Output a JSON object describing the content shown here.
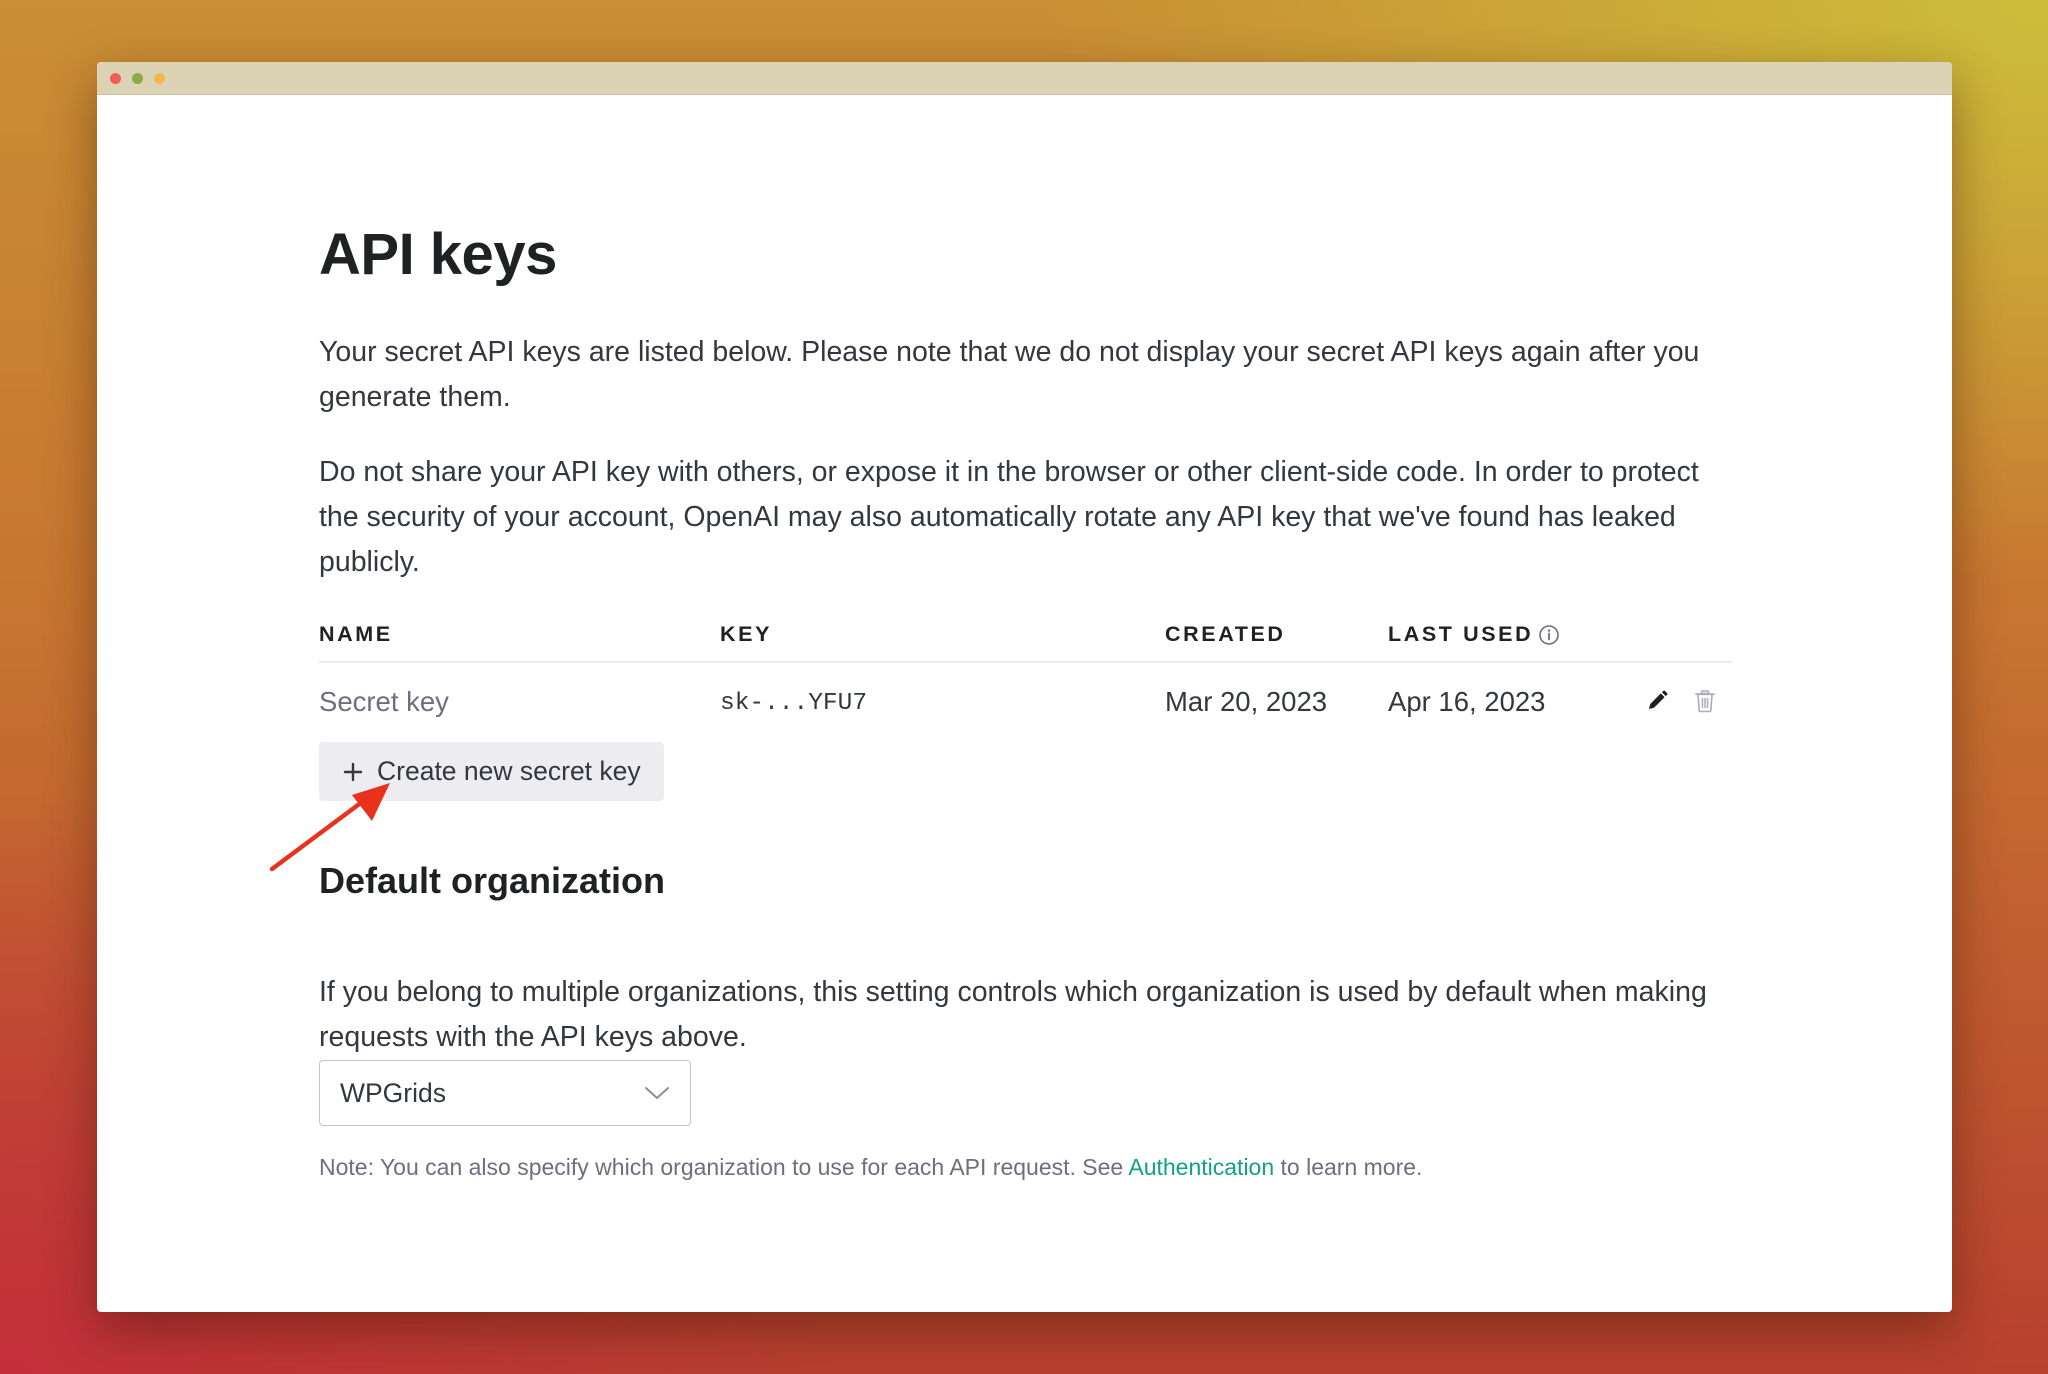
{
  "page": {
    "title": "API keys",
    "intro": "Your secret API keys are listed below. Please note that we do not display your secret API keys again after you generate them.",
    "warning": "Do not share your API key with others, or expose it in the browser or other client-side code. In order to protect the security of your account, OpenAI may also automatically rotate any API key that we've found has leaked publicly."
  },
  "keys_table": {
    "columns": {
      "name": "NAME",
      "key": "KEY",
      "created": "CREATED",
      "last_used": "LAST USED"
    },
    "rows": [
      {
        "name": "Secret key",
        "key": "sk-...YFU7",
        "created": "Mar 20, 2023",
        "last_used": "Apr 16, 2023"
      }
    ],
    "icons": {
      "info": "info-icon",
      "edit": "pencil-icon",
      "delete": "trash-icon"
    }
  },
  "create_button": {
    "label": "Create new secret key",
    "icon": "plus-icon"
  },
  "default_org": {
    "title": "Default organization",
    "description": "If you belong to multiple organizations, this setting controls which organization is used by default when making requests with the API keys above.",
    "selected": "WPGrids",
    "note_prefix": "Note: You can also specify which organization to use for each API request. See ",
    "note_link": "Authentication",
    "note_suffix": " to learn more."
  },
  "colors": {
    "accent_link": "#10a37f",
    "annotation_arrow": "#e8321e",
    "button_bg": "#ececf1"
  }
}
